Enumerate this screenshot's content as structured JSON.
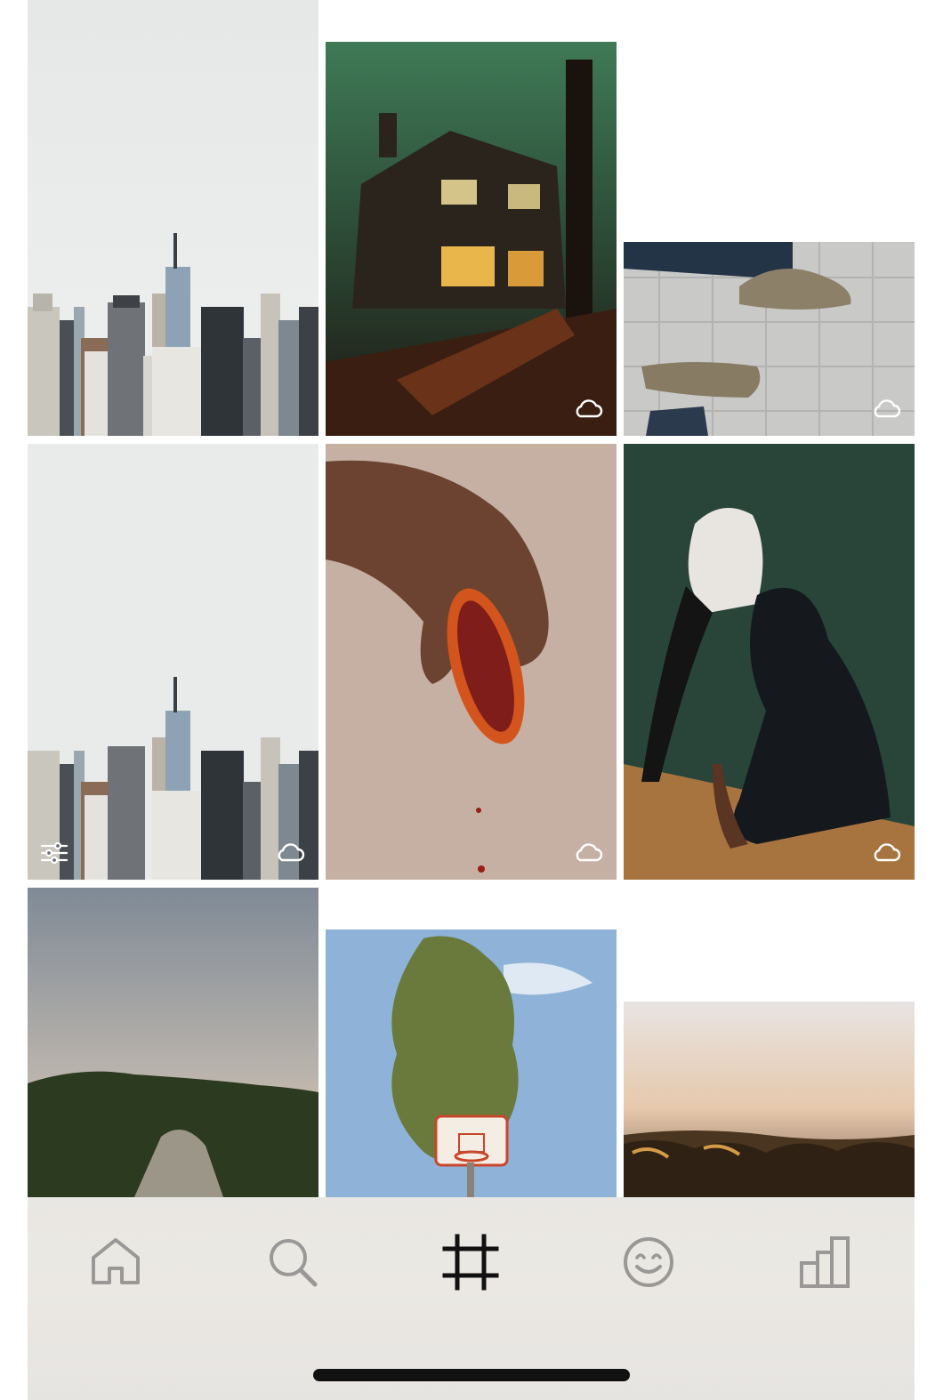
{
  "grid": {
    "tiles": [
      {
        "id": "skyline-1",
        "synced": false,
        "edited": false
      },
      {
        "id": "house",
        "synced": true,
        "edited": false
      },
      {
        "id": "shoes",
        "synced": true,
        "edited": false
      },
      {
        "id": "skyline-2",
        "synced": true,
        "edited": true
      },
      {
        "id": "orange",
        "synced": true,
        "edited": false
      },
      {
        "id": "dancer",
        "synced": true,
        "edited": false
      },
      {
        "id": "hill",
        "synced": false,
        "edited": false
      },
      {
        "id": "tree-hoop",
        "synced": false,
        "edited": false
      },
      {
        "id": "shore",
        "synced": false,
        "edited": false
      }
    ]
  },
  "tabbar": {
    "items": [
      {
        "icon": "home-icon",
        "active": false
      },
      {
        "icon": "search-icon",
        "active": false
      },
      {
        "icon": "crop-icon",
        "active": true
      },
      {
        "icon": "smiley-icon",
        "active": false
      },
      {
        "icon": "chart-icon",
        "active": false
      }
    ],
    "active_color": "#111111",
    "inactive_color": "#9a9896"
  }
}
